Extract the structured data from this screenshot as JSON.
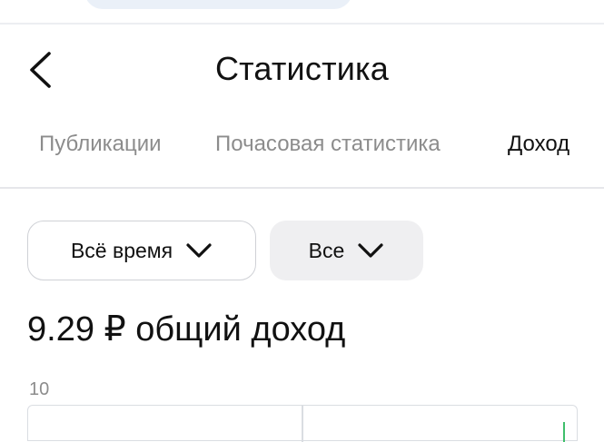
{
  "header": {
    "title": "Статистика",
    "back_icon": "chevron-left-icon"
  },
  "tabs": [
    {
      "label": "Публикации",
      "active": false
    },
    {
      "label": "Почасовая статистика",
      "active": false
    },
    {
      "label": "Доход",
      "active": true
    }
  ],
  "filters": {
    "period": {
      "label": "Всё время",
      "icon": "chevron-down-icon"
    },
    "type": {
      "label": "Все",
      "icon": "chevron-down-icon"
    }
  },
  "summary": {
    "total_text": "9.29 ₽ общий доход"
  },
  "chart": {
    "y_tick_top": "10"
  },
  "colors": {
    "text_primary": "#111111",
    "text_secondary": "#8c8c8c",
    "chip_fill": "#efeff1",
    "chip_border": "#cfd1d6",
    "series_green": "#3fbf6b"
  }
}
